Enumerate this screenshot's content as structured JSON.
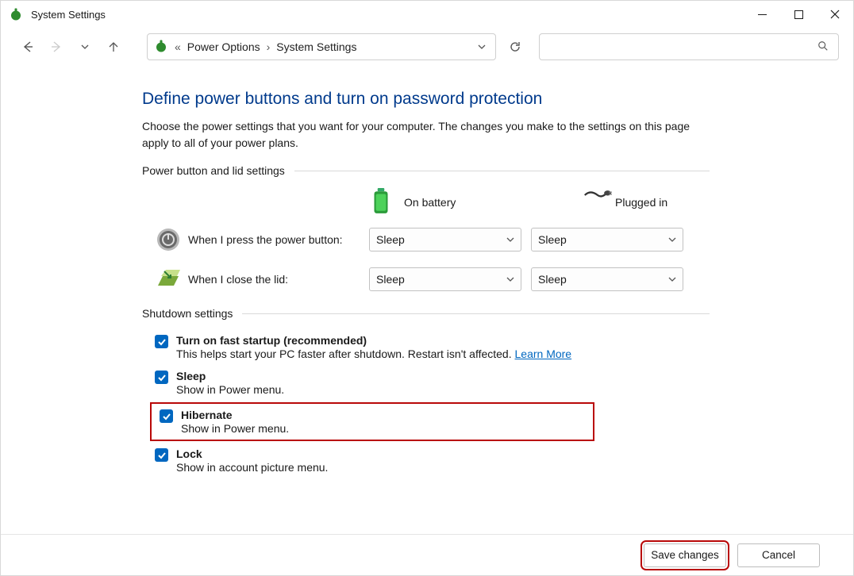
{
  "window": {
    "title": "System Settings"
  },
  "breadcrumb": {
    "level1": "Power Options",
    "level2": "System Settings",
    "overflow": "«"
  },
  "page": {
    "title": "Define power buttons and turn on password protection",
    "description": "Choose the power settings that you want for your computer. The changes you make to the settings on this page apply to all of your power plans."
  },
  "sections": {
    "power_button": "Power button and lid settings",
    "shutdown": "Shutdown settings"
  },
  "columns": {
    "battery": "On battery",
    "plugged": "Plugged in"
  },
  "rows": {
    "power_button_label": "When I press the power button:",
    "lid_label": "When I close the lid:",
    "power_button_battery": "Sleep",
    "power_button_plugged": "Sleep",
    "lid_battery": "Sleep",
    "lid_plugged": "Sleep"
  },
  "shutdown_items": {
    "fast_startup": {
      "title": "Turn on fast startup (recommended)",
      "desc": "This helps start your PC faster after shutdown. Restart isn't affected. ",
      "link": "Learn More",
      "checked": true
    },
    "sleep": {
      "title": "Sleep",
      "desc": "Show in Power menu.",
      "checked": true
    },
    "hibernate": {
      "title": "Hibernate",
      "desc": "Show in Power menu.",
      "checked": true
    },
    "lock": {
      "title": "Lock",
      "desc": "Show in account picture menu.",
      "checked": true
    }
  },
  "footer": {
    "save": "Save changes",
    "cancel": "Cancel"
  }
}
